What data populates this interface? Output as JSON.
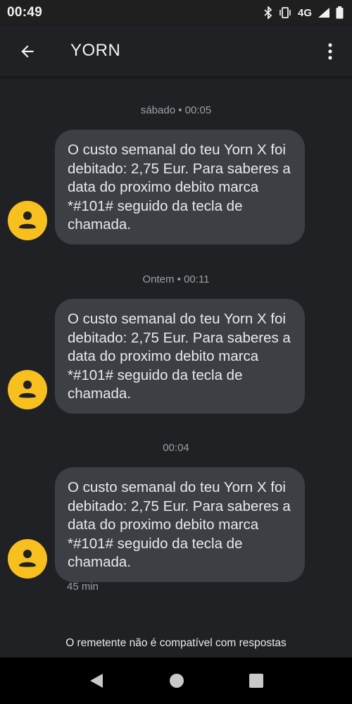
{
  "status": {
    "time": "00:49",
    "network": "4G"
  },
  "header": {
    "title": "YORN",
    "back_icon": "arrow-back-icon",
    "more_icon": "more-vert-icon"
  },
  "messages": [
    {
      "date": "sábado • 00:05",
      "text": "O custo semanal do teu Yorn X foi debitado: 2,75 Eur. Para saberes a data do proximo debito marca *#101# seguido da tecla de chamada."
    },
    {
      "date": "Ontem • 00:11",
      "text": "O custo semanal do teu Yorn X foi debitado: 2,75 Eur. Para saberes a data do proximo debito marca *#101# seguido da tecla de chamada."
    },
    {
      "date": "00:04",
      "text": "O custo semanal do teu Yorn X foi debitado: 2,75 Eur. Para saberes a data do proximo debito marca *#101# seguido da tecla de chamada.",
      "meta": "45 min"
    }
  ],
  "footer": {
    "note": "O remetente não é compatível com respostas"
  },
  "colors": {
    "avatar": "#f7c01f",
    "bubble": "#3c3f43",
    "background": "#202124"
  }
}
